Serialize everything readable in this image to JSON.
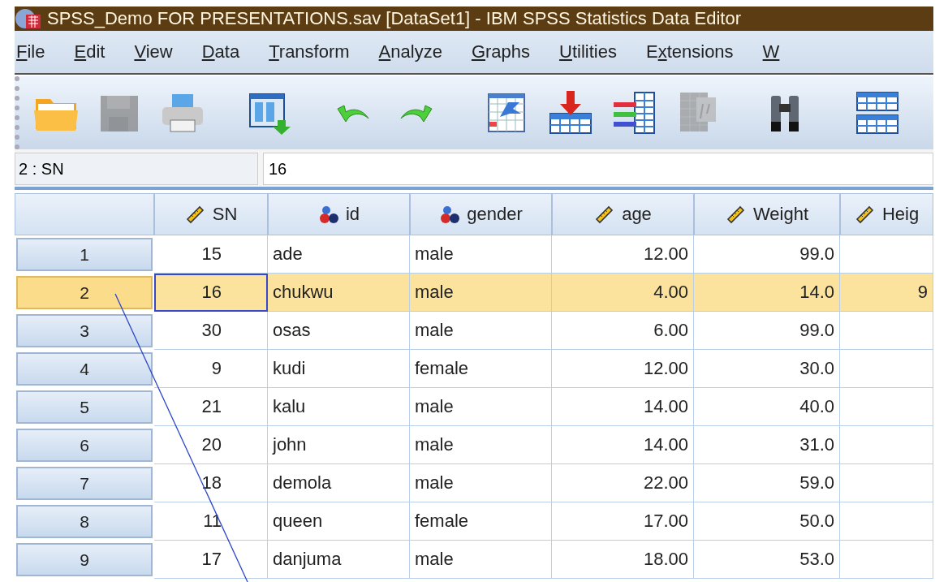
{
  "window": {
    "title": "SPSS_Demo FOR PRESENTATIONS.sav [DataSet1] - IBM SPSS Statistics Data Editor"
  },
  "menu": [
    {
      "key": "F",
      "after": "ile"
    },
    {
      "key": "E",
      "after": "dit"
    },
    {
      "key": "V",
      "after": "iew"
    },
    {
      "key": "D",
      "after": "ata"
    },
    {
      "key": "T",
      "after": "ransform"
    },
    {
      "key": "A",
      "after": "nalyze"
    },
    {
      "key": "G",
      "after": "raphs"
    },
    {
      "key": "U",
      "after": "tilities"
    },
    {
      "before": "E",
      "key": "x",
      "after": "tensions"
    },
    {
      "key": "W"
    }
  ],
  "toolbar": [
    {
      "kind": "open",
      "disabled": false
    },
    {
      "kind": "save",
      "disabled": true
    },
    {
      "kind": "print",
      "disabled": false
    },
    {
      "kind": "goto",
      "disabled": false
    },
    {
      "kind": "undo",
      "disabled": false
    },
    {
      "kind": "redo",
      "disabled": false
    },
    {
      "kind": "recall",
      "disabled": false
    },
    {
      "kind": "insert_cases",
      "disabled": false
    },
    {
      "kind": "insert_variable",
      "disabled": false
    },
    {
      "kind": "split",
      "disabled": true
    },
    {
      "kind": "find",
      "disabled": false
    },
    {
      "kind": "tables",
      "disabled": false
    }
  ],
  "cell_editor": {
    "reference": "2 : SN",
    "value": "16"
  },
  "table": {
    "columns": [
      {
        "label": "SN",
        "kind": "scale"
      },
      {
        "label": "id",
        "kind": "nominal"
      },
      {
        "label": "gender",
        "kind": "nominal"
      },
      {
        "label": "age",
        "kind": "scale"
      },
      {
        "label": "Weight",
        "kind": "scale"
      },
      {
        "label": "Heig",
        "kind": "scale"
      }
    ],
    "rows": [
      {
        "number": "1",
        "selected": false,
        "cells": [
          "15",
          "ade",
          "male",
          "12.00",
          "99.0"
        ]
      },
      {
        "number": "2",
        "selected": true,
        "cells": [
          "16",
          "chukwu",
          "male",
          "4.00",
          "14.0",
          "9"
        ]
      },
      {
        "number": "3",
        "selected": false,
        "cells": [
          "30",
          "osas",
          "male",
          "6.00",
          "99.0"
        ]
      },
      {
        "number": "4",
        "selected": false,
        "cells": [
          "9",
          "kudi",
          "female",
          "12.00",
          "30.0"
        ]
      },
      {
        "number": "5",
        "selected": false,
        "cells": [
          "21",
          "kalu",
          "male",
          "14.00",
          "40.0"
        ]
      },
      {
        "number": "6",
        "selected": false,
        "cells": [
          "20",
          "john",
          "male",
          "14.00",
          "31.0"
        ]
      },
      {
        "number": "7",
        "selected": false,
        "cells": [
          "18",
          "demola",
          "male",
          "22.00",
          "59.0"
        ]
      },
      {
        "number": "8",
        "selected": false,
        "cells": [
          "11",
          "queen",
          "female",
          "17.00",
          "50.0"
        ]
      },
      {
        "number": "9",
        "selected": false,
        "cells": [
          "17",
          "danjuma",
          "male",
          "18.00",
          "53.0"
        ]
      }
    ]
  }
}
